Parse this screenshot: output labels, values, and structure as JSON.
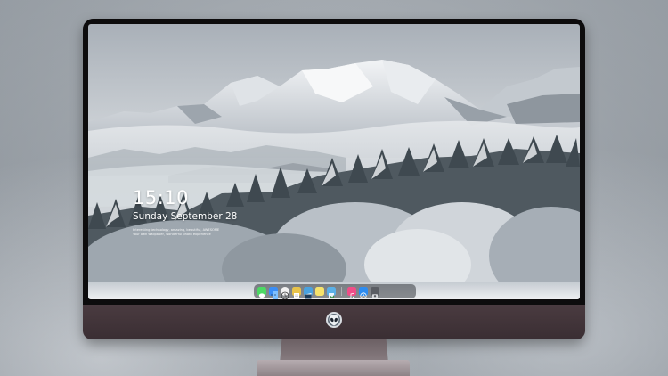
{
  "lock_screen": {
    "time": "15:10",
    "date": "Sunday September 28",
    "note_lines": [
      "Interesting technology, amazing, beautiful, AWESOME",
      "Your own wallpaper, wonderful photo experience"
    ]
  },
  "dock": {
    "items": [
      {
        "name": "messages-icon",
        "color": "#4cd964"
      },
      {
        "name": "finder-icon",
        "color": "#3a8ef6"
      },
      {
        "name": "clock-icon",
        "color": "#f2f2f2"
      },
      {
        "name": "notes-icon",
        "color": "#e8c34a"
      },
      {
        "name": "clapper-icon",
        "color": "#4aa3e0"
      },
      {
        "name": "stickies-icon",
        "color": "#f7e36b"
      },
      {
        "name": "preview-icon",
        "color": "#5ab0e8"
      },
      {
        "name": "music-icon",
        "color": "#f04e88"
      },
      {
        "name": "app-store-icon",
        "color": "#2d8cf0"
      },
      {
        "name": "camera-icon",
        "color": "#5a5d63"
      }
    ]
  },
  "monitor": {
    "frame_color": "#3a3034",
    "logo": "alien-head-logo"
  }
}
